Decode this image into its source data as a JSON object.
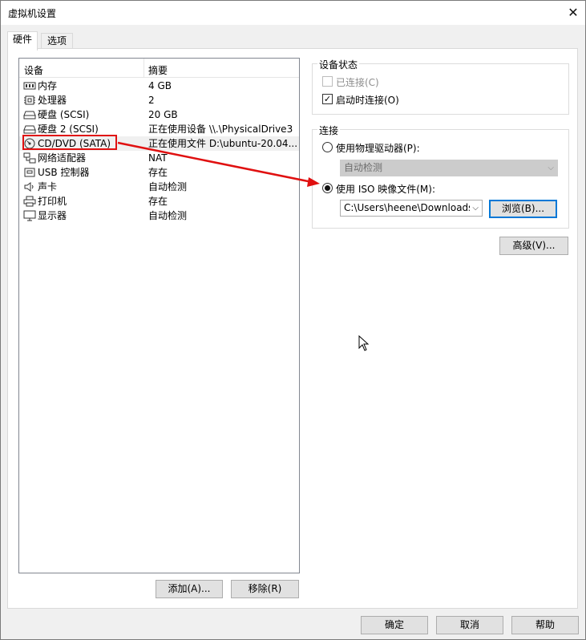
{
  "window": {
    "title": "虚拟机设置",
    "close_glyph": "✕"
  },
  "tabs": [
    {
      "label": "硬件",
      "active": true
    },
    {
      "label": "选项",
      "active": false
    }
  ],
  "device_list": {
    "header_device": "设备",
    "header_summary": "摘要",
    "items": [
      {
        "name": "内存",
        "summary": "4 GB",
        "icon": "memory-icon"
      },
      {
        "name": "处理器",
        "summary": "2",
        "icon": "cpu-icon"
      },
      {
        "name": "硬盘 (SCSI)",
        "summary": "20 GB",
        "icon": "hard-disk-icon"
      },
      {
        "name": "硬盘 2 (SCSI)",
        "summary": "正在使用设备 \\\\.\\PhysicalDrive3",
        "icon": "hard-disk-icon"
      },
      {
        "name": "CD/DVD (SATA)",
        "summary": "正在使用文件 D:\\ubuntu-20.04...",
        "icon": "cd-dvd-icon",
        "selected": true
      },
      {
        "name": "网络适配器",
        "summary": "NAT",
        "icon": "network-icon"
      },
      {
        "name": "USB 控制器",
        "summary": "存在",
        "icon": "usb-icon"
      },
      {
        "name": "声卡",
        "summary": "自动检测",
        "icon": "speaker-icon"
      },
      {
        "name": "打印机",
        "summary": "存在",
        "icon": "printer-icon"
      },
      {
        "name": "显示器",
        "summary": "自动检测",
        "icon": "monitor-icon"
      }
    ]
  },
  "buttons": {
    "add": "添加(A)...",
    "remove": "移除(R)",
    "ok": "确定",
    "cancel": "取消",
    "help": "帮助",
    "advanced": "高级(V)...",
    "browse": "浏览(B)..."
  },
  "device_status": {
    "title": "设备状态",
    "connected_label": "已连接(C)",
    "connected_checked": false,
    "connected_enabled": false,
    "connect_on_power_label": "启动时连接(O)",
    "connect_on_power_checked": true
  },
  "connection": {
    "title": "连接",
    "physical_label": "使用物理驱动器(P):",
    "physical_selected": false,
    "physical_value": "自动检测",
    "iso_label": "使用 ISO 映像文件(M):",
    "iso_selected": true,
    "iso_path": "C:\\Users\\heene\\Downloads\\"
  },
  "annotation": {
    "highlight_color": "#e01010",
    "arrow_color": "#e01010"
  }
}
